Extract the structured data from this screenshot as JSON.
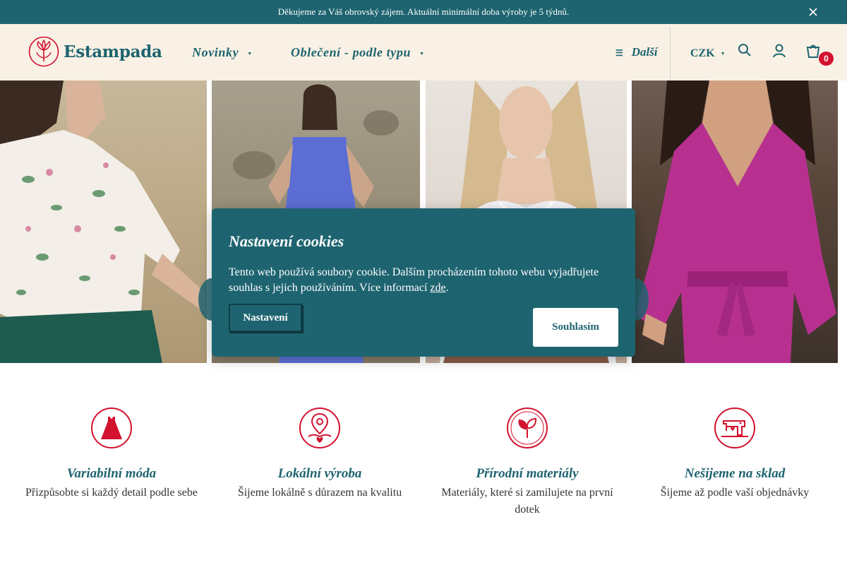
{
  "banner": {
    "text": "Děkujeme za Váš obrovský zájem. Aktuální minimální doba výroby je 5 týdnů."
  },
  "header": {
    "logo_text": "Estampada",
    "nav": [
      {
        "label": "Novinky"
      },
      {
        "label": "Oblečení - podle typu"
      }
    ],
    "more_label": "Další",
    "currency": "CZK",
    "cart_count": "0"
  },
  "cookie": {
    "title": "Nastavení cookies",
    "text": "Tento web používá soubory cookie. Dalším procházením tohoto webu vyjadřujete souhlas s jejich používáním. Více informací ",
    "link": "zde",
    "after_link": ".",
    "settings_button": "Nastavení",
    "accept_button": "Souhlasím"
  },
  "features": [
    {
      "title": "Variabilní móda",
      "desc": "Přizpůsobte si každý detail podle sebe",
      "icon": "dress-icon"
    },
    {
      "title": "Lokální výroba",
      "desc": "Šijeme lokálně s důrazem na kvalitu",
      "icon": "location-heart-icon"
    },
    {
      "title": "Přírodní materiály",
      "desc": "Materiály, které si zamilujete na první dotek",
      "icon": "leaf-icon"
    },
    {
      "title": "Nešijeme na sklad",
      "desc": "Šijeme až podle vaší objednávky",
      "icon": "sewing-machine-icon"
    }
  ],
  "colors": {
    "primary": "#1e6470",
    "accent": "#d2122e",
    "header_bg": "#f9f1e5"
  }
}
